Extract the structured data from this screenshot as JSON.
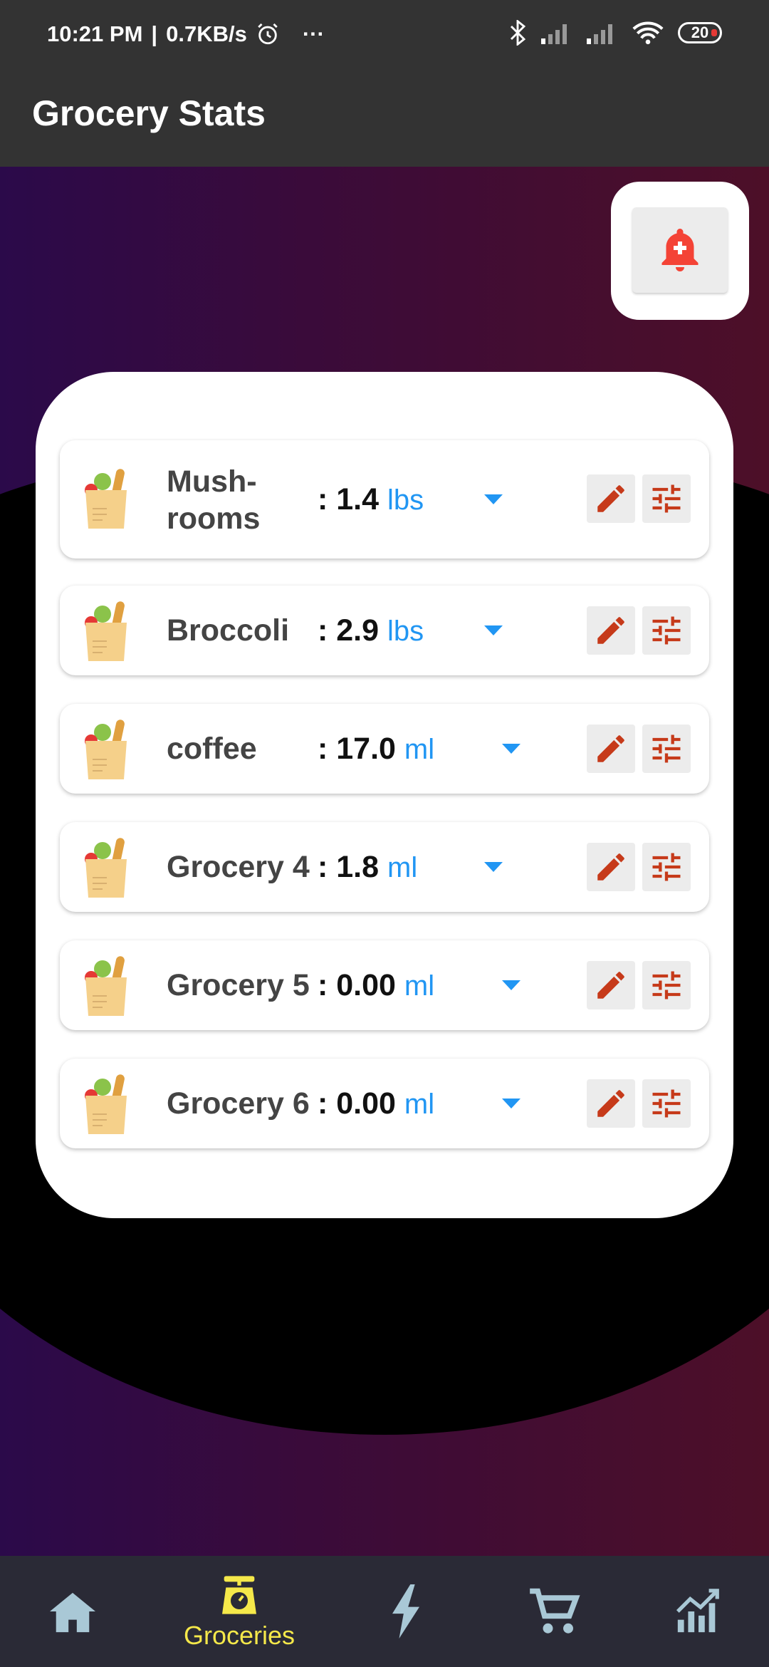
{
  "status_bar": {
    "time": "10:21 PM",
    "speed": "0.7KB/s",
    "more": "···",
    "battery": "20"
  },
  "app_bar": {
    "title": "Grocery Stats"
  },
  "groceries": [
    {
      "name": "Mush-rooms",
      "name_line1": "Mush-",
      "name_line2": "rooms",
      "qty": ": 1.4",
      "unit": "lbs"
    },
    {
      "name": "Broccoli",
      "qty": ": 2.9",
      "unit": "lbs"
    },
    {
      "name": "coffee",
      "qty": ": 17.0",
      "unit": "ml"
    },
    {
      "name": "Grocery 4",
      "qty": ": 1.8",
      "unit": "ml"
    },
    {
      "name": "Grocery 5",
      "qty": ": 0.00",
      "unit": "ml"
    },
    {
      "name": "Grocery 6",
      "qty": ": 0.00",
      "unit": "ml"
    }
  ],
  "bottom_nav": {
    "items": [
      {
        "icon": "home-icon",
        "label": ""
      },
      {
        "icon": "scale-icon",
        "label": "Groceries",
        "active": true
      },
      {
        "icon": "lightning-icon",
        "label": ""
      },
      {
        "icon": "cart-icon",
        "label": ""
      },
      {
        "icon": "chart-icon",
        "label": ""
      }
    ]
  },
  "colors": {
    "accent_blue": "#2196f3",
    "icon_red": "#c63a1a",
    "bell_red": "#f44336",
    "active_yellow": "#f5e84a"
  }
}
